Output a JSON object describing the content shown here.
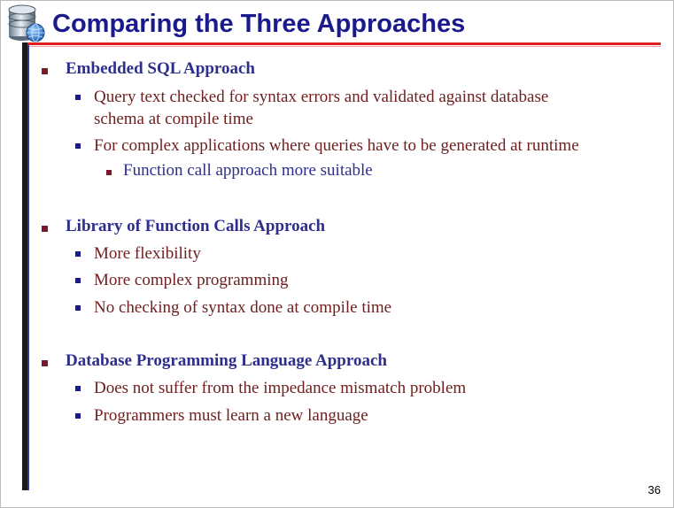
{
  "slide": {
    "title": "Comparing the Three Approaches",
    "page_number": "36",
    "sections": [
      {
        "heading": "Embedded SQL Approach",
        "points": [
          {
            "line1": "Query text checked for syntax errors and validated against database",
            "line2": "schema at compile time"
          },
          {
            "line1": "For complex applications where queries have to be generated at runtime"
          }
        ],
        "subpoint": "Function call approach more suitable"
      },
      {
        "heading": "Library of Function Calls Approach",
        "points": [
          {
            "line1": "More flexibility"
          },
          {
            "line1": "More complex programming"
          },
          {
            "line1": "No checking of syntax done at compile time"
          }
        ]
      },
      {
        "heading": "Database Programming Language Approach",
        "points": [
          {
            "line1": "Does not suffer from the impedance mismatch problem"
          },
          {
            "line1": "Programmers must learn a new language"
          }
        ]
      }
    ]
  },
  "colors": {
    "title": "#1a1a8c",
    "heading": "#2e2e8c",
    "body_text": "#6e1e1e",
    "accent_rule": "#e0201c"
  },
  "icons": {
    "logo": "database-globe-icon"
  }
}
